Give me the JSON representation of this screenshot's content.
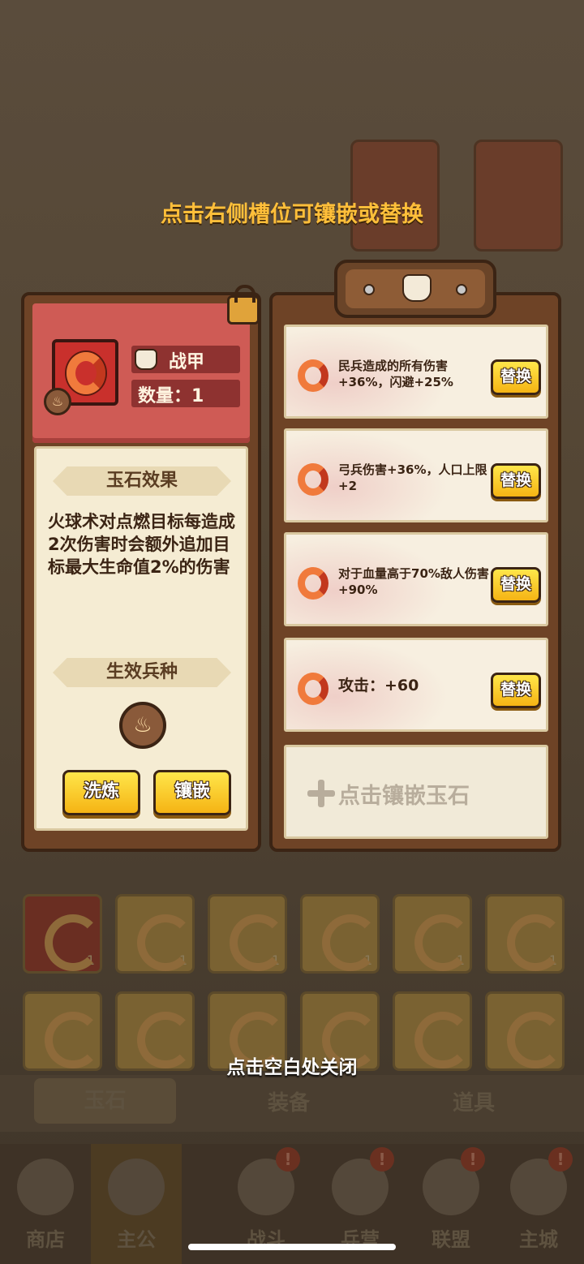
{
  "hint_top": "点击右侧槽位可镶嵌或替换",
  "hint_bottom": "点击空白处关闭",
  "gem": {
    "name": "战甲",
    "quantity_label": "数量：1",
    "effect_title": "玉石效果",
    "effect_text": "火球术对点燃目标每造成2次伤害时会额外追加目标最大生命值2%的伤害",
    "unit_title": "生效兵种",
    "refine_label": "洗炼",
    "inlay_label": "镶嵌"
  },
  "slots": [
    {
      "text": "民兵造成的所有伤害+36%，闪避+25%",
      "button": "替换"
    },
    {
      "text": "弓兵伤害+36%，人口上限+2",
      "button": "替换"
    },
    {
      "text": "对于血量高于70%敌人伤害+90%",
      "button": "替换"
    },
    {
      "text": "攻击：+60",
      "button": "替换"
    }
  ],
  "empty_slot_label": "点击镶嵌玉石",
  "background": {
    "tabs": [
      "玉石",
      "装备",
      "道具"
    ],
    "nav": [
      "商店",
      "主公",
      "战斗",
      "兵营",
      "联盟",
      "主城"
    ]
  },
  "colors": {
    "accent_yellow": "#f5b414",
    "panel_brown": "#6e4326",
    "header_red": "#cf5b55",
    "hint_orange": "#ffbf3a"
  }
}
